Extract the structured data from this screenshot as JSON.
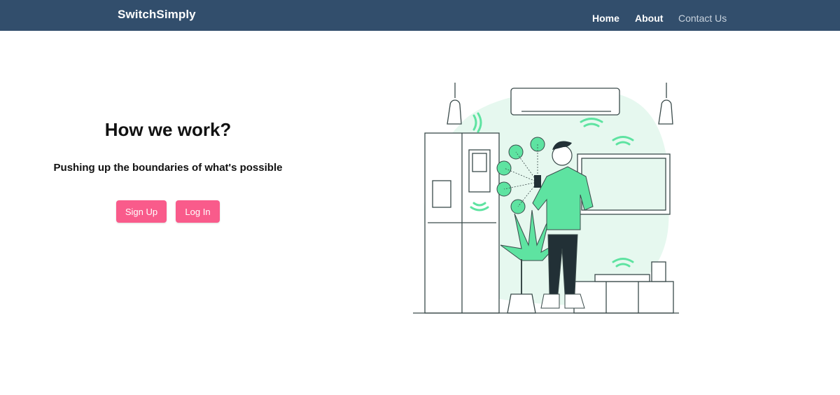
{
  "header": {
    "brand": "SwitchSimply",
    "nav": {
      "home": "Home",
      "about": "About",
      "contact": "Contact Us"
    }
  },
  "hero": {
    "title": "How we work?",
    "subtitle": "Pushing up the boundaries of what's possible",
    "signup_label": "Sign Up",
    "login_label": "Log In"
  },
  "colors": {
    "navbar": "#324e6c",
    "accent": "#f95b8b",
    "illustration_green": "#5ee3a1",
    "illustration_bg": "#e6f8ef"
  }
}
